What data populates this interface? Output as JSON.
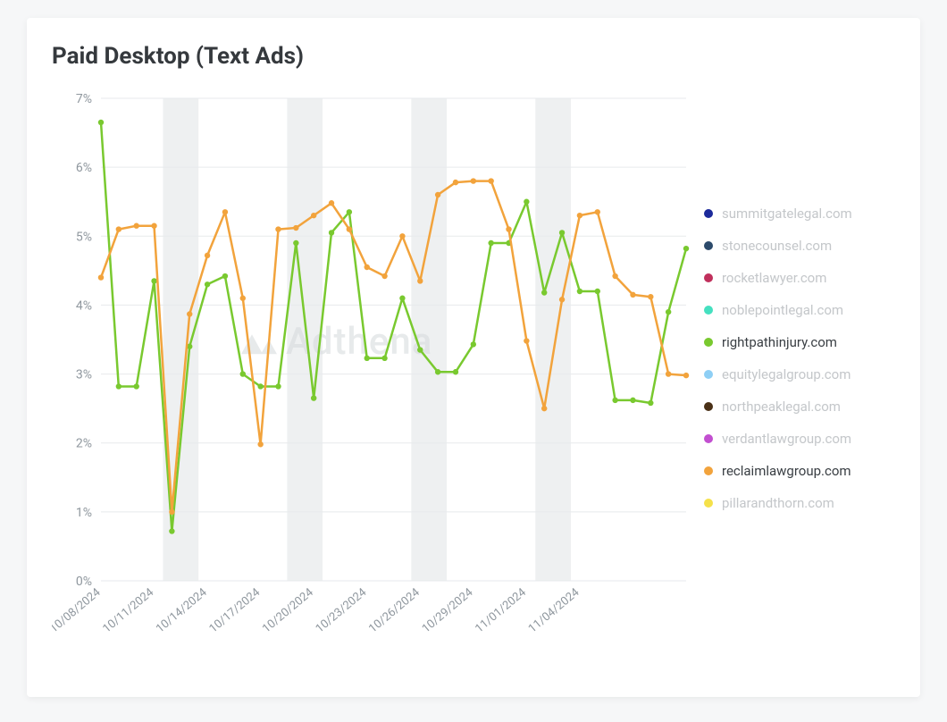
{
  "title": "Paid Desktop (Text Ads)",
  "watermark": "Adthena",
  "legend": [
    {
      "name": "summitgatelegal.com",
      "color": "#1c2a9b",
      "active": false
    },
    {
      "name": "stonecounsel.com",
      "color": "#2c4a6b",
      "active": false
    },
    {
      "name": "rocketlawyer.com",
      "color": "#c0305c",
      "active": false
    },
    {
      "name": "noblepointlegal.com",
      "color": "#45e0c0",
      "active": false
    },
    {
      "name": "rightpathinjury.com",
      "color": "#79c92f",
      "active": true
    },
    {
      "name": "equitylegalgroup.com",
      "color": "#8ecff5",
      "active": false
    },
    {
      "name": "northpeaklegal.com",
      "color": "#4a3016",
      "active": false
    },
    {
      "name": "verdantlawgroup.com",
      "color": "#c24fd0",
      "active": false
    },
    {
      "name": "reclaimlawgroup.com",
      "color": "#f2a33c",
      "active": true
    },
    {
      "name": "pillarandthorn.com",
      "color": "#f5e14a",
      "active": false
    }
  ],
  "chart_data": {
    "type": "line",
    "xlabel": "",
    "ylabel": "",
    "ylim": [
      0,
      7
    ],
    "y_ticks": [
      0,
      1,
      2,
      3,
      4,
      5,
      6,
      7
    ],
    "y_tick_labels": [
      "0%",
      "1%",
      "2%",
      "3%",
      "4%",
      "5%",
      "6%",
      "7%"
    ],
    "x_tick_labels": [
      "10/08/2024",
      "10/11/2024",
      "10/14/2024",
      "10/17/2024",
      "10/20/2024",
      "10/23/2024",
      "10/26/2024",
      "10/29/2024",
      "11/01/2024",
      "11/04/2024"
    ],
    "x_tick_indices": [
      0,
      3,
      6,
      9,
      12,
      15,
      18,
      21,
      24,
      27
    ],
    "x_count": 30,
    "weekend_band_start_indices": [
      4,
      11,
      18,
      25
    ],
    "series": [
      {
        "name": "rightpathinjury.com",
        "color": "#79c92f",
        "values": [
          6.65,
          2.82,
          2.82,
          4.35,
          0.72,
          3.4,
          4.3,
          4.42,
          3.0,
          2.82,
          2.82,
          4.9,
          2.65,
          5.05,
          5.35,
          3.23,
          3.23,
          4.1,
          3.35,
          3.03,
          3.03,
          3.43,
          4.9,
          4.9,
          5.5,
          4.18,
          5.05,
          4.2,
          4.2,
          2.62,
          2.62,
          2.58,
          3.9,
          4.82
        ]
      },
      {
        "name": "reclaimlawgroup.com",
        "color": "#f2a33c",
        "values": [
          4.4,
          5.1,
          5.15,
          5.15,
          1.0,
          3.87,
          4.72,
          5.35,
          4.1,
          1.98,
          5.1,
          5.12,
          5.3,
          5.48,
          5.1,
          4.55,
          4.42,
          5.0,
          4.35,
          5.6,
          5.78,
          5.8,
          5.8,
          5.1,
          3.48,
          2.5,
          4.08,
          5.3,
          5.35,
          4.42,
          4.15,
          4.12,
          3.0,
          2.98
        ]
      }
    ]
  }
}
